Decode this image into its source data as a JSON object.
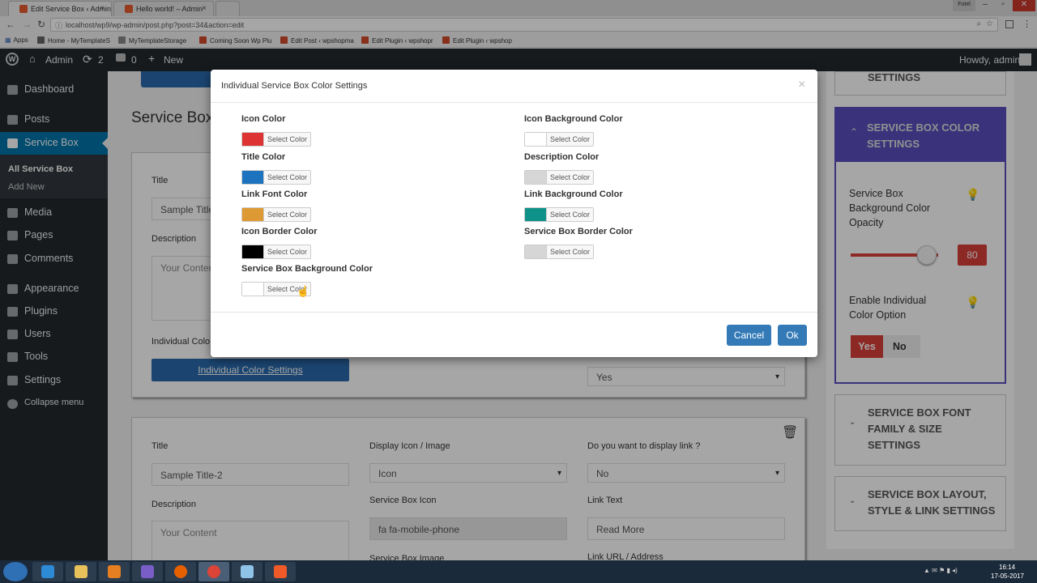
{
  "browser": {
    "tabs": [
      {
        "label": "Edit Service Box ‹ Admin",
        "active": true
      },
      {
        "label": "Hello world! – Admin",
        "active": false
      }
    ],
    "window_user": "Fotel",
    "url": "localhost/wp9/wp-admin/post.php?post=34&action=edit",
    "bookmarks": [
      "Apps",
      "Home - MyTemplateS",
      "MyTemplateStorage",
      "Coming Soon Wp Plu",
      "Edit Post ‹ wpshopma",
      "Edit Plugin ‹ wpshopr",
      "Edit Plugin ‹ wpshop"
    ]
  },
  "adminbar": {
    "site": "Admin",
    "updates": "2",
    "comments": "0",
    "new": "New",
    "howdy": "Howdy, admin"
  },
  "sidebar": {
    "items": [
      "Dashboard",
      "Posts",
      "Service Box",
      "Media",
      "Pages",
      "Comments",
      "Appearance",
      "Plugins",
      "Users",
      "Tools",
      "Settings",
      "Collapse menu"
    ],
    "submenu": [
      "All Service Box",
      "Add New"
    ]
  },
  "main": {
    "page_title": "Service Box",
    "card1": {
      "title_label": "Title",
      "title_value": "Sample Title",
      "desc_label": "Description",
      "desc_placeholder": "Your Content",
      "indiv_label": "Individual Colo",
      "indiv_button": "Individual Color Settings",
      "link_select": "Yes"
    },
    "card2": {
      "title_label": "Title",
      "title_value": "Sample Title-2",
      "desc_label": "Description",
      "desc_placeholder": "Your Content",
      "display_label": "Display Icon / Image",
      "display_value": "Icon",
      "icon_label": "Service Box Icon",
      "icon_value": "fa fa-mobile-phone",
      "image_label": "Service Box Image",
      "link_q_label": "Do you want to display link ?",
      "link_q_value": "No",
      "link_text_label": "Link Text",
      "link_text_value": "Read More",
      "link_url_label": "Link URL / Address"
    }
  },
  "right": {
    "settings_top": "SETTINGS",
    "color_head_1": "SERVICE BOX COLOR",
    "color_head_2": "SETTINGS",
    "opacity_label_1": "Service Box",
    "opacity_label_2": "Background Color",
    "opacity_label_3": "Opacity",
    "opacity_value": "80",
    "enable_label_1": "Enable Individual",
    "enable_label_2": "Color Option",
    "yes": "Yes",
    "no": "No",
    "font_head_1": "SERVICE BOX FONT",
    "font_head_2": "FAMILY & SIZE",
    "font_head_3": "SETTINGS",
    "layout_head_1": "SERVICE BOX LAYOUT,",
    "layout_head_2": "STYLE & LINK SETTINGS"
  },
  "modal": {
    "title": "Individual Service Box Color Settings",
    "close": "×",
    "select_label": "Select Color",
    "fields_left": [
      {
        "label": "Icon Color",
        "color": "#dd3333"
      },
      {
        "label": "Title Color",
        "color": "#1e73be"
      },
      {
        "label": "Link Font Color",
        "color": "#dd9933"
      },
      {
        "label": "Icon Border Color",
        "color": "#000000"
      },
      {
        "label": "Service Box Background Color",
        "color": "#ffffff"
      }
    ],
    "fields_right": [
      {
        "label": "Icon Background Color",
        "color": "#ffffff"
      },
      {
        "label": "Description Color",
        "color": "#d6d6d6"
      },
      {
        "label": "Link Background Color",
        "color": "#0e9188"
      },
      {
        "label": "Service Box Border Color",
        "color": "#d6d6d6"
      }
    ],
    "cancel": "Cancel",
    "ok": "Ok"
  },
  "taskbar": {
    "time": "16:14",
    "date": "17-05-2017"
  },
  "colors": {
    "wp_dark": "#23282d",
    "wp_blue": "#0073aa",
    "purple_header": "#5a4fbd",
    "slider_red": "#d9403a",
    "btn_blue": "#337ab7"
  }
}
